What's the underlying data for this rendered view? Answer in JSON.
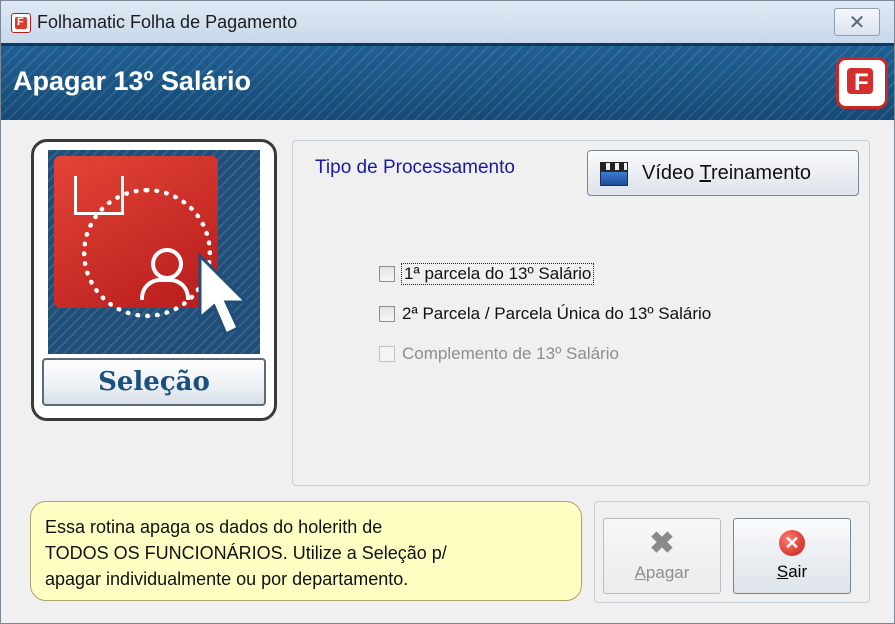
{
  "window": {
    "title": "Folhamatic Folha de Pagamento",
    "close_glyph": "✕"
  },
  "header": {
    "title": "Apagar 13º Salário"
  },
  "selection": {
    "button_label": "Seleção"
  },
  "processing": {
    "label": "Tipo de Processamento",
    "video_button": {
      "pre": "Vídeo ",
      "underlined": "T",
      "post": "reinamento"
    },
    "options": [
      {
        "label": "1ª parcela do 13º Salário",
        "checked": false,
        "enabled": true
      },
      {
        "label": "2ª Parcela / Parcela Única do 13º Salário",
        "checked": false,
        "enabled": true
      },
      {
        "label": "Complemento de 13º Salário",
        "checked": false,
        "enabled": false
      }
    ]
  },
  "info_message": {
    "line1": "Essa rotina apaga os dados do holerith de",
    "line2": "TODOS OS FUNCIONÁRIOS. Utilize a Seleção p/",
    "line3": "apagar individualmente ou por departamento."
  },
  "actions": {
    "delete": {
      "underlined": "A",
      "rest": "pagar",
      "enabled": false
    },
    "exit": {
      "underlined": "S",
      "rest": "air",
      "enabled": true
    }
  }
}
